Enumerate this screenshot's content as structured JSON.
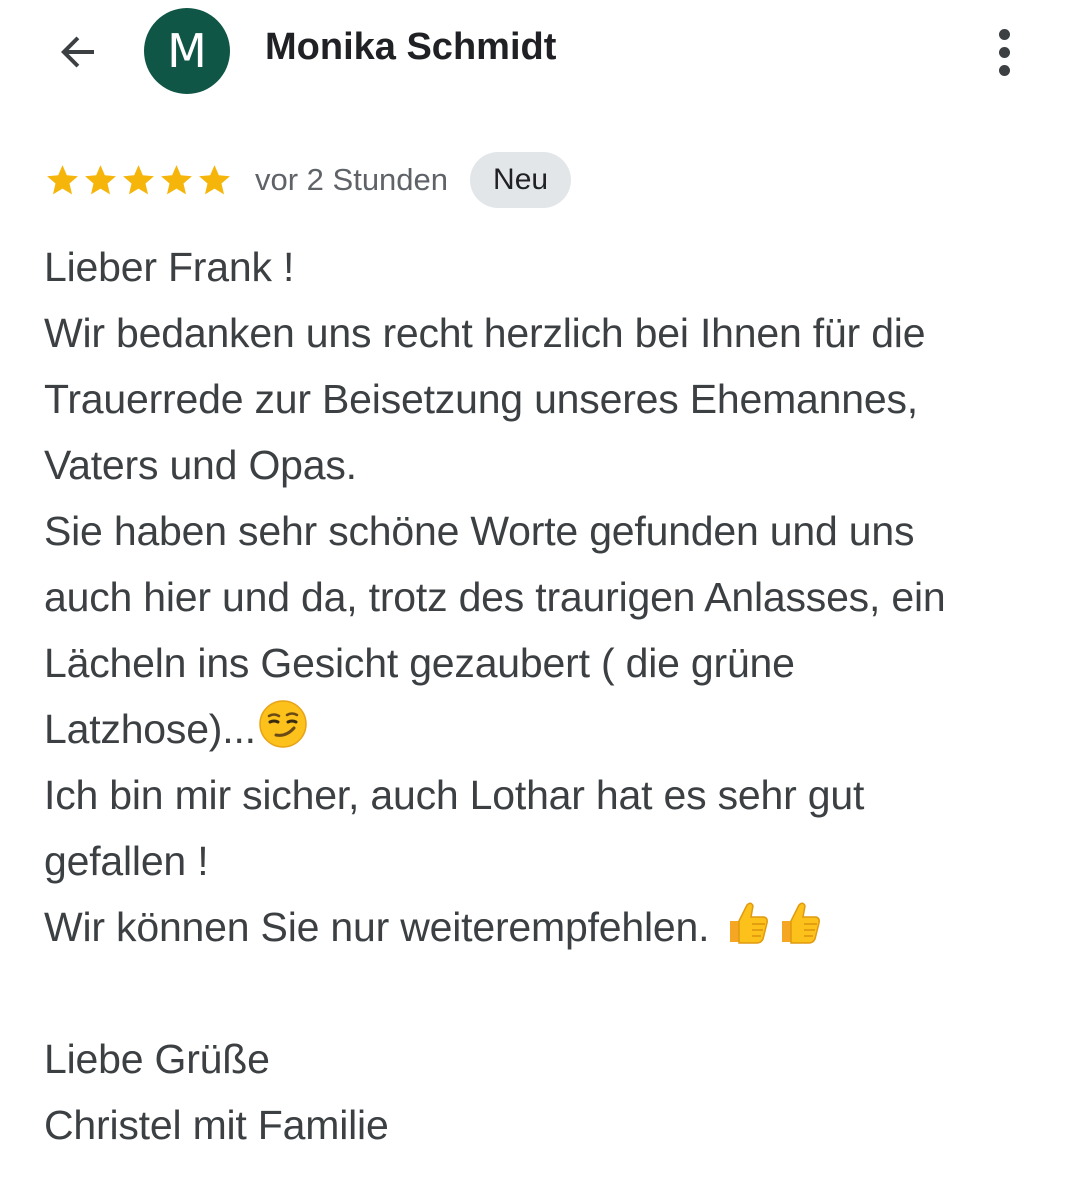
{
  "header": {
    "back_icon": "arrow-left-icon",
    "avatar_letter": "M",
    "avatar_color": "#0f5646",
    "author_name": "Monika Schmidt",
    "more_icon": "more-vert-icon"
  },
  "review": {
    "rating": 5,
    "max_rating": 5,
    "star_color": "#f5b50a",
    "time_ago": "vor 2 Stunden",
    "badge": "Neu",
    "lines": [
      "Lieber Frank !",
      "Wir bedanken uns recht herzlich bei Ihnen für die",
      "Trauerrede zur Beisetzung unseres Ehemannes,",
      "Vaters und Opas.",
      "Sie haben sehr schöne Worte gefunden und uns",
      "auch hier und da, trotz des traurigen Anlasses, ein",
      "Lächeln ins Gesicht gezaubert ( die grüne",
      "Latzhose)...",
      "Ich bin mir sicher, auch Lothar hat es sehr gut",
      "gefallen !",
      "Wir können Sie nur weiterempfehlen. ",
      "",
      "Liebe Grüße",
      "Christel mit Familie"
    ],
    "emojis": {
      "smirk": "smirking-face-emoji",
      "thumbs": "thumbs-up-emoji"
    }
  }
}
